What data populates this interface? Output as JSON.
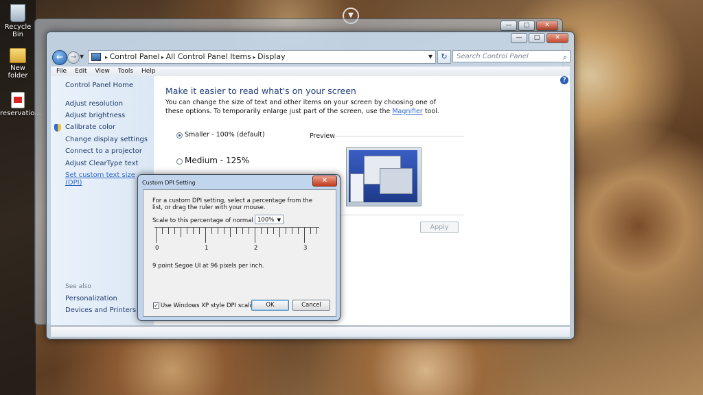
{
  "desktop": {
    "icons": [
      {
        "label": "Recycle Bin",
        "icon": "recycle-bin-icon"
      },
      {
        "label": "New folder",
        "icon": "folder-icon"
      },
      {
        "label": "reservatio...",
        "icon": "pdf-icon"
      }
    ]
  },
  "window": {
    "breadcrumb": [
      "Control Panel",
      "All Control Panel Items",
      "Display"
    ],
    "search_placeholder": "Search Control Panel",
    "menu": [
      "File",
      "Edit",
      "View",
      "Tools",
      "Help"
    ],
    "controls": {
      "minimize": "—",
      "maximize": "□",
      "close": "✕"
    }
  },
  "sidebar": {
    "home": "Control Panel Home",
    "items": [
      "Adjust resolution",
      "Adjust brightness",
      "Calibrate color",
      "Change display settings",
      "Connect to a projector",
      "Adjust ClearType text",
      "Set custom text size (DPI)"
    ],
    "see_also_label": "See also",
    "see_also": [
      "Personalization",
      "Devices and Printers"
    ]
  },
  "main": {
    "heading": "Make it easier to read what's on your screen",
    "desc_before": "You can change the size of text and other items on your screen by choosing one of these options. To temporarily enlarge just part of the screen, use the ",
    "desc_link": "Magnifier",
    "desc_after": " tool.",
    "options": [
      {
        "label": "Smaller - 100% (default)",
        "selected": true
      },
      {
        "label": "Medium - 125%",
        "selected": false
      }
    ],
    "preview_label": "Preview",
    "apply_label": "Apply"
  },
  "dialog": {
    "title": "Custom DPI Setting",
    "close": "✕",
    "instructions": "For a custom DPI setting, select a percentage from the list, or drag the ruler with your mouse.",
    "scale_label": "Scale to this percentage of normal size:",
    "scale_value": "100%",
    "ruler_numbers": [
      "0",
      "1",
      "2",
      "3"
    ],
    "info": "9 point Segoe UI at 96 pixels per inch.",
    "checkbox_label": "Use Windows XP style DPI scaling",
    "checkbox_checked": true,
    "checkbox_mark": "✓",
    "ok_label": "OK",
    "cancel_label": "Cancel"
  }
}
